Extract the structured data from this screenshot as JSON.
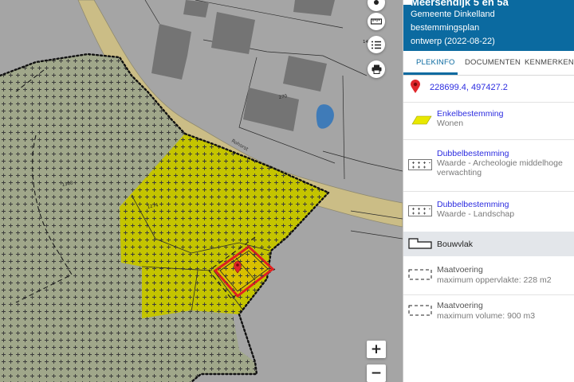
{
  "map": {
    "street_label": "Rohorst",
    "parcel_labels": [
      "1308",
      "1274",
      "1275",
      "1416",
      "270"
    ],
    "zoom_in": "+",
    "zoom_out": "−",
    "tools": [
      "location-icon",
      "ruler-icon",
      "list-icon",
      "print-icon"
    ]
  },
  "panel": {
    "title": "Meersendijk 5 en 5a",
    "municipality": "Gemeente Dinkelland",
    "plan_type": "bestemmingsplan",
    "status": "ontwerp (2022-08-22)",
    "tabs": [
      {
        "label": "PLEKINFO",
        "active": true
      },
      {
        "label": "DOCUMENTEN",
        "active": false
      },
      {
        "label": "KENMERKEN",
        "active": false
      }
    ],
    "coordinates": "228699.4, 497427.2",
    "items": [
      {
        "title": "Enkelbestemming",
        "value": "Wonen"
      },
      {
        "title": "Dubbelbestemming",
        "value": "Waarde - Archeologie middelhoge verwachting"
      },
      {
        "title": "Dubbelbestemming",
        "value": "Waarde - Landschap"
      },
      {
        "title": "Bouwvlak",
        "value": ""
      },
      {
        "title": "Maatvoering",
        "value": "maximum oppervlakte: 228 m2"
      },
      {
        "title": "Maatvoering",
        "value": "maximum volume: 900 m3"
      }
    ]
  },
  "colors": {
    "accent": "#0b6aa0",
    "link": "#2c2ce0",
    "wonen": "#c4c400",
    "road": "#cbbd86",
    "water": "#3f7bb8",
    "marker": "#e0262b"
  }
}
